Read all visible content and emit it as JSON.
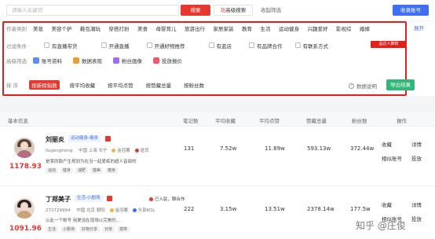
{
  "search": {
    "placeholder": "请输入关键词",
    "button_label": "搜索",
    "advanced_label": "高级搜索",
    "advanced_prefix": "功",
    "fav_filter_label": "收起筛选",
    "fav_account_label": "收录账号"
  },
  "filters": {
    "category_label": "作者类别",
    "categories": [
      "美妆",
      "美容个护",
      "鞋包潮玩",
      "穿搭打扮",
      "美食",
      "母婴育儿",
      "旅游出行",
      "家居家装",
      "教育",
      "生活",
      "运动健身",
      "兴趣爱好",
      "影视综",
      "婚嫁"
    ],
    "expand_label": "展开",
    "condition_label": "过滤条件",
    "conditions": [
      "有直播带货",
      "开通直播",
      "开通好物推荐",
      "有蓝店",
      "有品牌合作",
      "有联系方式"
    ],
    "red_tag": "品达人推荐",
    "advanced_label": "高级筛选",
    "advanced_items": [
      "账号资料",
      "数据表现",
      "粉丝画像",
      "投放报价"
    ],
    "sort_label": "排 序",
    "sort_options": [
      "按新榜指数",
      "按平均收藏",
      "按平均点赞",
      "按赞藏总量",
      "按粉丝数"
    ],
    "data_note_label": "数据说明",
    "export_label": "导出结果"
  },
  "table": {
    "headers": [
      "基本信息",
      "笔记数",
      "平均收藏",
      "平均点赞",
      "赞藏总量",
      "粉丝数",
      "操作"
    ],
    "rows": [
      {
        "name": "刘丽炎",
        "category": "运动健身-健身",
        "xhs_id": "liugenghong",
        "location": "中国 上海 长宁",
        "badge_1": "金冠薯",
        "badge_2": "退货",
        "score": "1178.93",
        "desc": "是某同款产生规划为在当一起爱练的超人音部的",
        "chips": [
          "运动",
          "健身",
          "减肥",
          "健美",
          "瘦身"
        ],
        "notes": "131",
        "avg_fav": "7.52w",
        "avg_like": "11.89w",
        "total": "593.13w",
        "fans": "372.44w",
        "action_1": "收藏",
        "action_2": "详情",
        "action_3": "相似账号",
        "action_4": "投放"
      },
      {
        "name": "丁郑美子",
        "category": "生活-小剧场",
        "xhs_id": "272729994",
        "location": "中国 北京 朝阳",
        "badge_1": "金冠薯",
        "badge_2": "头部KOL",
        "extra": "已入驻，聊合作",
        "score": "1091.96",
        "desc": "以此一个账号 用更加在现场以完美的...",
        "chips": [
          "生活",
          "小剧场",
          "好物分享",
          "日常",
          "搞笑"
        ],
        "notes": "222",
        "avg_fav": "3.15w",
        "avg_like": "13.51w",
        "total": "2378.14w",
        "fans": "177.5w",
        "action_1": "收藏",
        "action_2": "详情",
        "action_3": "相似账号",
        "action_4": "投放"
      }
    ]
  },
  "watermark": "知乎 @庄俊",
  "colors": {
    "brand_red": "#e8372e",
    "highlight_box": "#e0211b",
    "brand_blue": "#3e6ff4",
    "export_green": "#31b777"
  }
}
